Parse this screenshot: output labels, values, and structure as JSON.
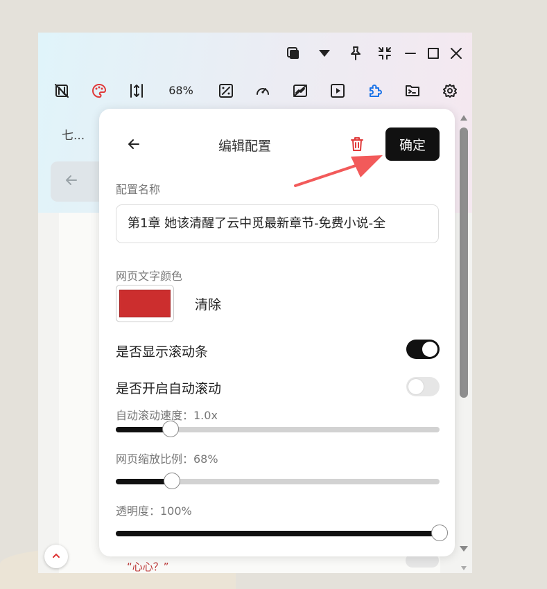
{
  "window": {
    "controls": [
      "copy-window-icon",
      "caret-down-icon",
      "pin-icon",
      "shrink-icon",
      "minimize-icon",
      "maximize-icon",
      "close-icon"
    ]
  },
  "toolbar": {
    "zoom_label": "68%",
    "tools": [
      "no-style-icon",
      "palette-icon",
      "vertical-resize-icon",
      "percent-icon",
      "speedometer-icon",
      "chart-off-icon",
      "play-icon",
      "puzzle-icon",
      "terminal-icon",
      "gear-icon"
    ]
  },
  "browser": {
    "tab_label": "七...",
    "page_text": "“心心？”"
  },
  "panel": {
    "title": "编辑配置",
    "confirm_label": "确定",
    "name_label": "配置名称",
    "name_value": "第1章 她该清醒了云中觅最新章节-免费小说-全",
    "text_color_label": "网页文字颜色",
    "text_color": "#cc2e2e",
    "clear_label": "清除",
    "show_scrollbar_label": "是否显示滚动条",
    "show_scrollbar_on": true,
    "auto_scroll_label": "是否开启自动滚动",
    "auto_scroll_on": false,
    "speed_label": "自动滚动速度：1.0x",
    "speed_fraction": 0.17,
    "zoom_label": "网页缩放比例：68%",
    "zoom_fraction": 0.173,
    "opacity_label": "透明度：100%",
    "opacity_fraction": 1.0
  },
  "annotation_arrow_color": "#f25a5a"
}
